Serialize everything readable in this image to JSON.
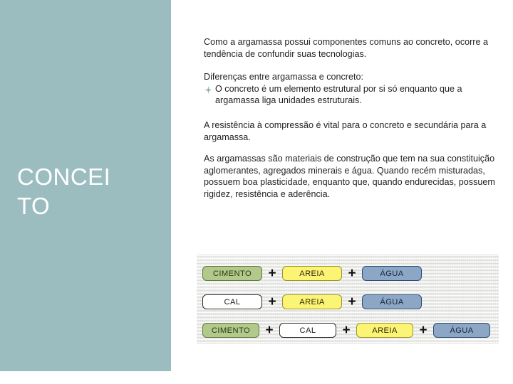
{
  "slide": {
    "title_lines": "CONCEI\nTO",
    "side_panel_color": "#9cbdc0"
  },
  "content": {
    "paragraph_1": "Como a argamassa possui componentes comuns ao concreto, ocorre a tendência de confundir suas tecnologias.",
    "paragraph_2_heading": "Diferenças entre argamassa e concreto:",
    "paragraph_2_bullet": "O concreto é um elemento estrutural por si só enquanto que a argamassa liga unidades estruturais.",
    "paragraph_3": "A resistência à compressão é vital para o concreto e secundária para a argamassa.",
    "paragraph_4": "As argamassas são materiais de construção que tem na sua constituição aglomerantes, agregados minerais e água. Quando recém misturadas, possuem boa plasticidade, enquanto que, quando endurecidas, possuem rigidez, resistência e aderência."
  },
  "diagram": {
    "plus_symbol": "+",
    "colors": {
      "cimento_fill": "#b2c98c",
      "cimento_border": "#5f7a3a",
      "areia_fill": "#fbf474",
      "areia_border": "#9c9524",
      "agua_fill": "#8ca6c6",
      "agua_border": "#2b4c75",
      "cal_fill": "#ffffff",
      "cal_border": "#2a2a2a"
    },
    "rows": [
      {
        "items": [
          "CIMENTO",
          "AREIA",
          "ÁGUA"
        ]
      },
      {
        "items": [
          "CAL",
          "AREIA",
          "ÁGUA"
        ]
      },
      {
        "items": [
          "CIMENTO",
          "CAL",
          "AREIA",
          "ÁGUA"
        ]
      }
    ]
  }
}
